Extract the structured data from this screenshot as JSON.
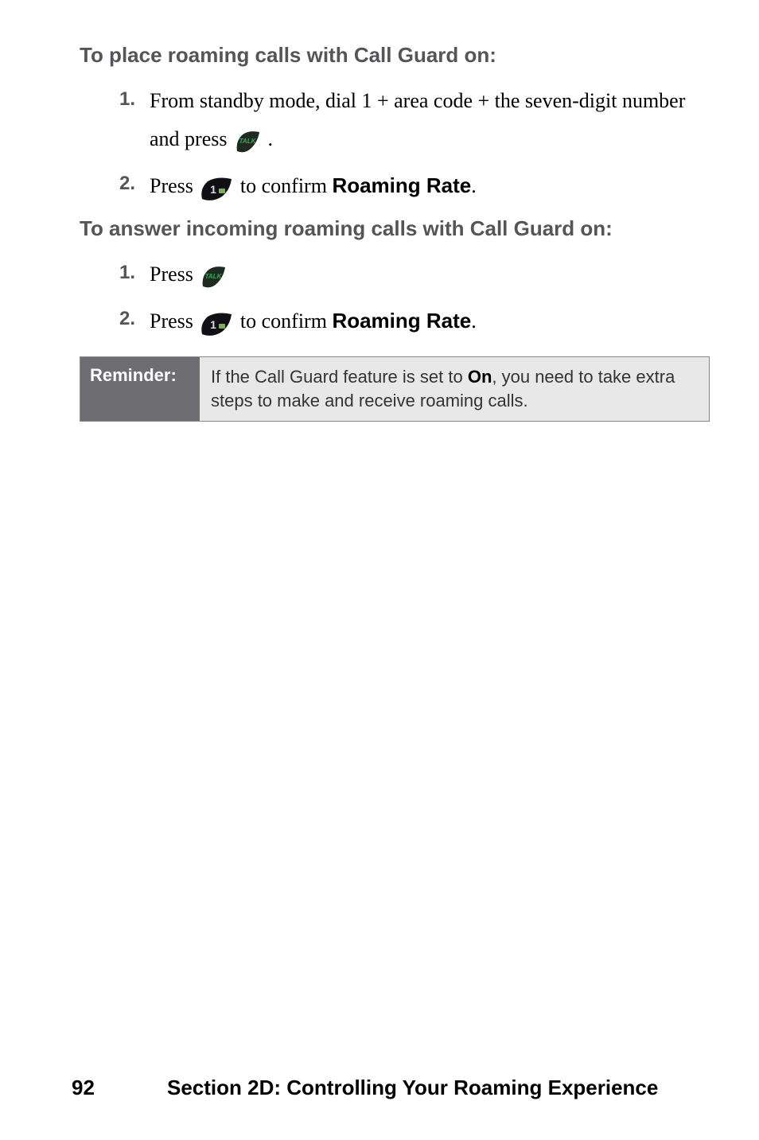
{
  "sections": {
    "place_heading": "To place roaming calls with Call Guard on:",
    "place_steps": [
      {
        "num": "1.",
        "pre": "From standby mode, dial 1 + area code + the seven-digit number and press ",
        "post": "."
      },
      {
        "num": "2.",
        "pre": "Press ",
        "mid": " to confirm ",
        "label": "Roaming Rate",
        "post": "."
      }
    ],
    "answer_heading": "To answer incoming roaming calls with Call Guard on:",
    "answer_steps": [
      {
        "num": "1.",
        "pre": "Press "
      },
      {
        "num": "2.",
        "pre": "Press ",
        "mid": " to confirm ",
        "label": "Roaming Rate",
        "post": "."
      }
    ]
  },
  "reminder": {
    "label": "Reminder:",
    "body_pre": "If the Call Guard feature is set to ",
    "body_bold": "On",
    "body_post": ", you need to take extra steps to make and receive roaming calls."
  },
  "footer": {
    "page": "92",
    "title": "Section 2D: Controlling Your Roaming Experience"
  },
  "icons": {
    "talk": "talk-key-icon",
    "one": "one-key-icon"
  }
}
